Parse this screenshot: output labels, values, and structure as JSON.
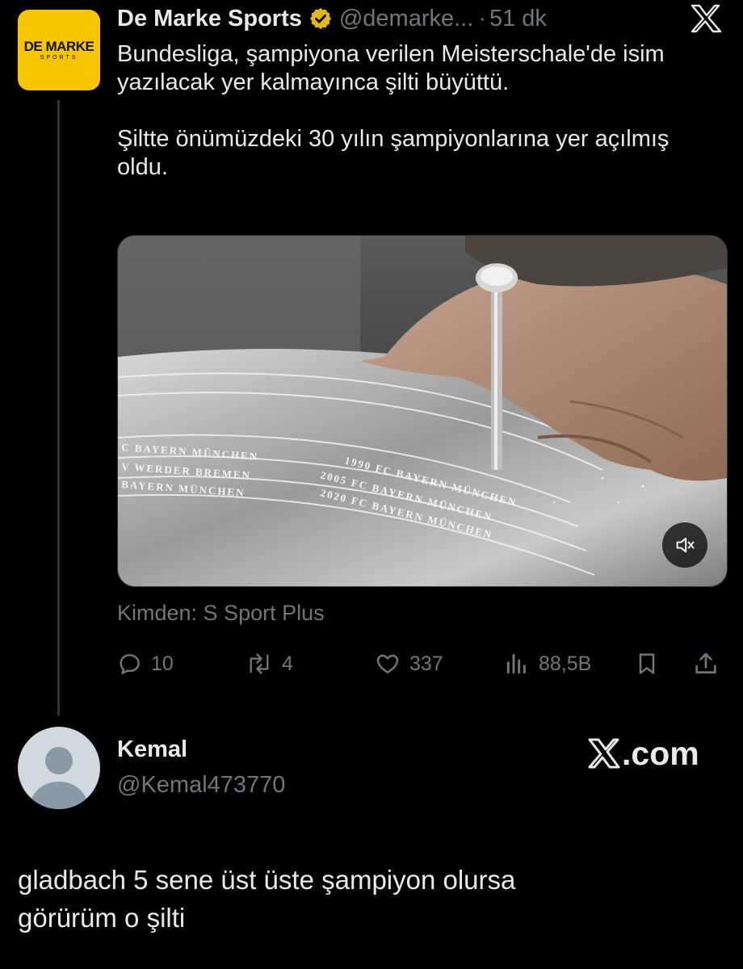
{
  "tweet": {
    "author_name": "De Marke Sports",
    "author_handle": "@demarke...",
    "separator": "·",
    "time": "51 dk",
    "avatar_logo_main": "DE MARKE",
    "avatar_logo_sub": "SPORTS",
    "verified_badge_color": "#e2b719",
    "text_paragraphs": [
      "Bundesliga, şampiyona verilen Meisterschale'de isim yazılacak yer kalmayınca şilti büyüttü.",
      "Şiltte önümüzdeki 30 yılın şampiyonlarına yer açılmış oldu."
    ],
    "media": {
      "engraving_lines": [
        "C BAYERN MÜNCHEN",
        "V WERDER BREMEN",
        "BAYERN MÜNCHEN",
        "1990 FC BAYERN MÜNCHEN",
        "2005 FC BAYERN MÜNCHEN",
        "2020 FC BAYERN MÜNCHEN"
      ],
      "volume_icon": "speaker-muted-icon"
    },
    "source": "Kimden: S Sport Plus",
    "actions": {
      "replies": "10",
      "reposts": "4",
      "likes": "337",
      "views": "88,5B"
    }
  },
  "reply": {
    "name": "Kemal",
    "handle": "@Kemal473770",
    "watermark": ".com",
    "text_lines": [
      "gladbach 5 sene üst üste şampiyon olursa",
      "görürüm o şilti"
    ]
  },
  "colors": {
    "background": "#000000",
    "text_primary": "#e7e9ea",
    "text_secondary": "#71767b",
    "brand_yellow": "#f6c500",
    "thread_line": "#333639"
  }
}
